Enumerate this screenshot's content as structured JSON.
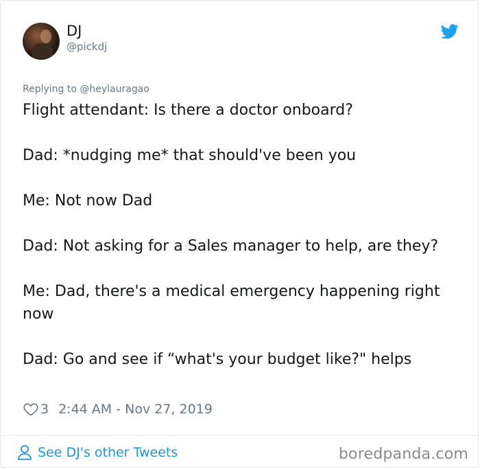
{
  "author": {
    "name": "DJ",
    "handle": "@pickdj"
  },
  "reply": {
    "prefix": "Replying to",
    "handle": "@heylauragao"
  },
  "tweet": {
    "lines": [
      "Flight attendant: Is there a doctor onboard?",
      "Dad: *nudging me* that should've been you",
      "Me: Not now Dad",
      "Dad: Not asking for a Sales manager to help, are they?",
      "Me: Dad, there's a medical emergency happening right now",
      "Dad: Go and see if “what's your budget like?\" helps"
    ]
  },
  "meta": {
    "likes": "3",
    "timestamp": "2:44 AM - Nov 27, 2019"
  },
  "footer": {
    "see_more_label": "See DJ's other Tweets"
  },
  "watermark": "boredpanda.com",
  "icons": {
    "brand": "twitter-bird-icon",
    "like": "heart-outline-icon",
    "profile": "person-outline-icon"
  },
  "colors": {
    "twitter_blue": "#1da1f2",
    "link_blue": "#1b95e0",
    "text_primary": "#14171a",
    "text_secondary": "#657786",
    "border": "#e1e8ed"
  }
}
